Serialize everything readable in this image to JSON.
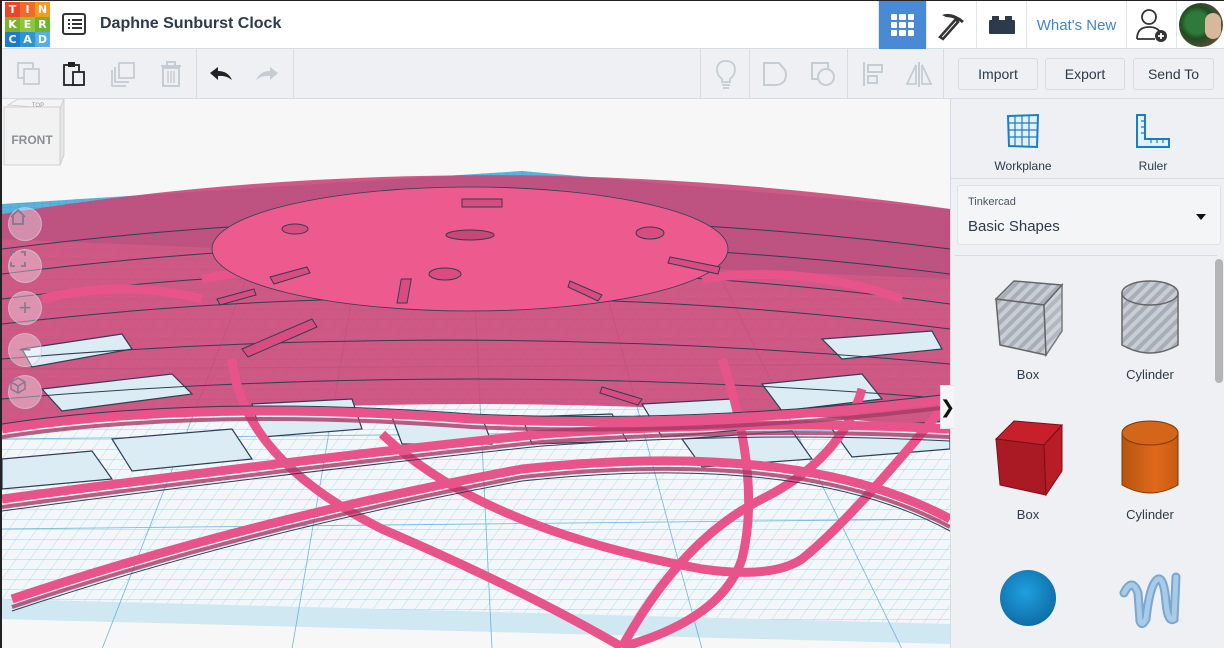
{
  "app": {
    "logo_letters": [
      "T",
      "I",
      "N",
      "K",
      "E",
      "R",
      "C",
      "A",
      "D"
    ],
    "logo_colors": [
      "#e8452c",
      "#f06a2b",
      "#f49a1f",
      "#7ab32a",
      "#8cc63f",
      "#6bb52f",
      "#1f7ac9",
      "#2b95d6",
      "#56b0e5"
    ],
    "title": "Daphne Sunburst Clock",
    "accent_color": "#4a8ad4"
  },
  "topbar": {
    "design_list_icon": "list-icon",
    "buttons": [
      {
        "name": "3d-design",
        "icon": "grid-icon",
        "active": true
      },
      {
        "name": "minecraft",
        "icon": "pickaxe-icon",
        "active": false
      },
      {
        "name": "lego",
        "icon": "brick-icon",
        "active": false
      }
    ],
    "whats_new_label": "What's New",
    "user_icon": "user-add-icon",
    "avatar_icon": "avatar"
  },
  "toolbar": {
    "left_tools": [
      {
        "name": "copy",
        "icon": "copy-icon",
        "enabled": false
      },
      {
        "name": "paste",
        "icon": "paste-icon",
        "enabled": true
      },
      {
        "name": "duplicate",
        "icon": "duplicate-icon",
        "enabled": false
      },
      {
        "name": "delete",
        "icon": "trash-icon",
        "enabled": false
      },
      {
        "name": "undo",
        "icon": "undo-icon",
        "enabled": true
      },
      {
        "name": "redo",
        "icon": "redo-icon",
        "enabled": false
      }
    ],
    "right_tools": [
      {
        "name": "notes",
        "icon": "lightbulb-icon",
        "enabled": false
      },
      {
        "name": "group",
        "icon": "group-icon",
        "enabled": false
      },
      {
        "name": "ungroup",
        "icon": "ungroup-icon",
        "enabled": false
      },
      {
        "name": "align",
        "icon": "align-icon",
        "enabled": false
      },
      {
        "name": "mirror",
        "icon": "mirror-icon",
        "enabled": false
      }
    ],
    "import_label": "Import",
    "export_label": "Export",
    "send_to_label": "Send To"
  },
  "viewport": {
    "viewcube": {
      "top_label": "TOP",
      "front_label": "FRONT"
    },
    "nav_buttons": [
      {
        "name": "home-view",
        "icon": "home-icon"
      },
      {
        "name": "fit-all",
        "icon": "fit-icon"
      },
      {
        "name": "zoom-in",
        "icon": "plus-icon",
        "glyph": "+"
      },
      {
        "name": "zoom-out",
        "icon": "minus-icon",
        "glyph": "−"
      },
      {
        "name": "projection",
        "icon": "cube-icon"
      }
    ],
    "model_color": "#e8538a",
    "grid_color": "#4aa3d6"
  },
  "panel": {
    "workplane_label": "Workplane",
    "ruler_label": "Ruler",
    "library": {
      "category": "Tinkercad",
      "selected": "Basic Shapes"
    },
    "shapes": [
      {
        "label": "Box",
        "kind": "hole-box"
      },
      {
        "label": "Cylinder",
        "kind": "hole-cylinder"
      },
      {
        "label": "Box",
        "kind": "box",
        "color": "#c8202b"
      },
      {
        "label": "Cylinder",
        "kind": "cylinder",
        "color": "#e06a1b"
      },
      {
        "label": "",
        "kind": "sphere",
        "color": "#1a8fd0"
      },
      {
        "label": "",
        "kind": "scribble",
        "color": "#8fb8dc"
      }
    ],
    "collapse_glyph": "❯"
  }
}
